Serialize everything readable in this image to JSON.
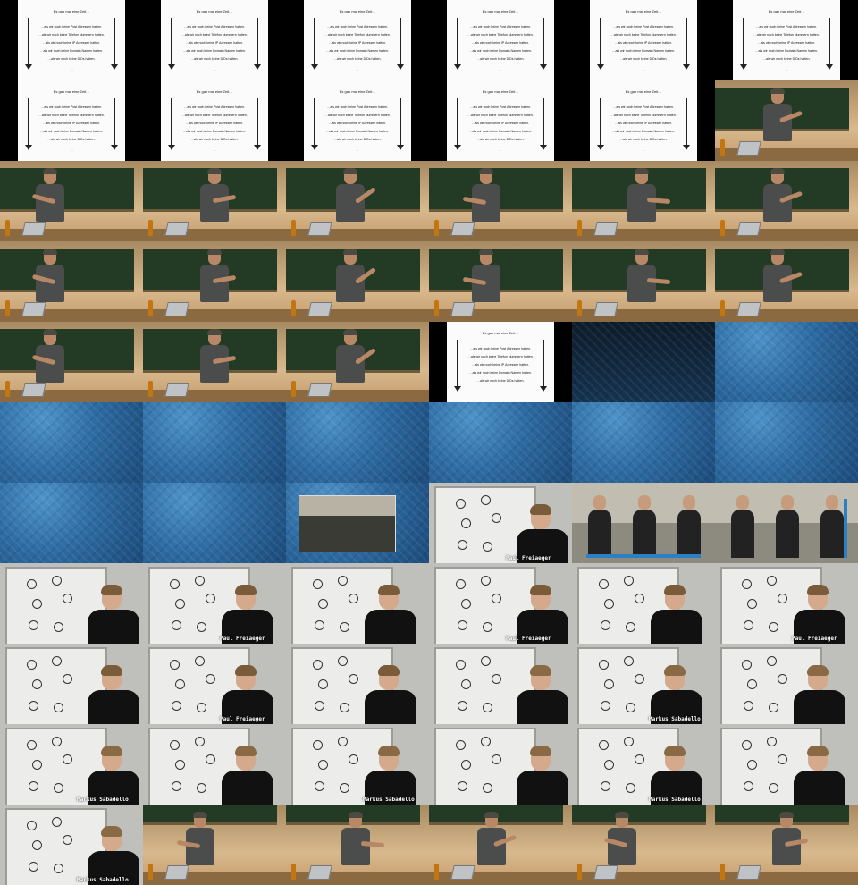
{
  "slide": {
    "title": "Es gab mal eine Zeit…",
    "lines": [
      "…als wir noch keine Post Adressen hatten.",
      "…als wir noch keine Telefon Nummern hatten.",
      "…als wir noch keine IP Adressen hatten.",
      "…als wir noch keine Domain Namen hatten.",
      "…als wir noch keine DIDs hatten."
    ],
    "ellipsis": "…"
  },
  "captions": {
    "speaker_one": "Paul Freiaeger",
    "speaker_two": "Markus Sabadello"
  },
  "frames": [
    "slide",
    "slide",
    "slide",
    "slide",
    "slide",
    "slide",
    "slide",
    "slide",
    "slide",
    "slide",
    "slide",
    "lecture",
    "lecture",
    "lecture",
    "lecture",
    "lecture",
    "lecture",
    "lecture",
    "lecture",
    "lecture",
    "lecture",
    "lecture",
    "lecture",
    "lecture",
    "lecture",
    "lecture",
    "lecture",
    "slide",
    "blue-dark",
    "blue",
    "blue",
    "blue",
    "blue",
    "blue",
    "blue",
    "blue",
    "blue",
    "blue",
    "blue-inset",
    "wb-one",
    "room",
    "room-vbar",
    "wb-one",
    "wb-one",
    "wb-one-arm",
    "wb-one-arm",
    "wb-one",
    "wb-one",
    "wb-one",
    "wb-one",
    "wb-one",
    "wb-two",
    "wb-two",
    "wb-two",
    "wb-two",
    "wb-two",
    "wb-two",
    "wb-two",
    "wb-two",
    "wb-two",
    "wb-two",
    "lecture",
    "lecture",
    "lecture",
    "lecture",
    "lecture"
  ]
}
